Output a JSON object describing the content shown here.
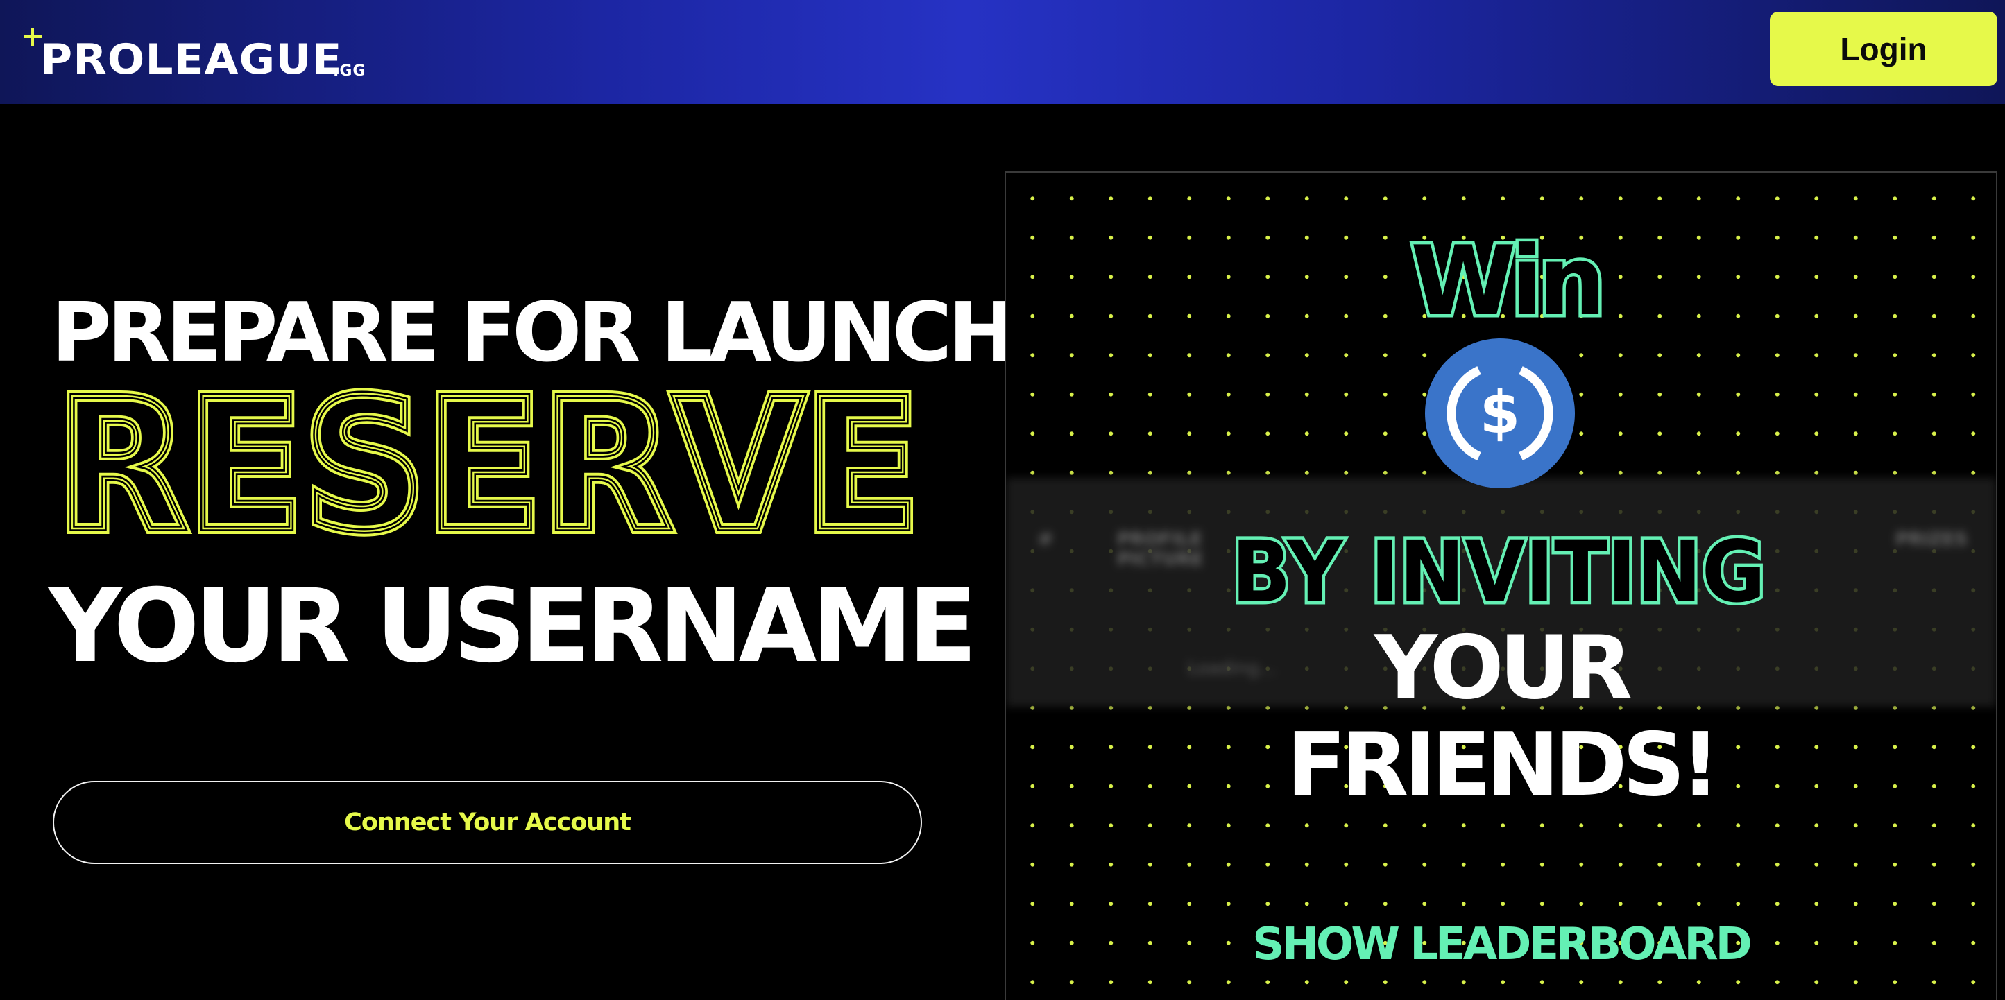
{
  "header": {
    "brand": "PROLEAGUE",
    "brand_suffix": ".GG",
    "login_label": "Login"
  },
  "hero": {
    "line1": "PREPARE FOR LAUNCH",
    "line2": "RESERVE",
    "line3": "YOUR USERNAME",
    "cta_label": "Connect Your Account"
  },
  "promo": {
    "win": "Win",
    "coin_icon": "usdc-coin-icon",
    "line_invite": "BY INVITING",
    "line_your": "YOUR",
    "line_friends": "FRIENDS!",
    "leaderboard_label": "SHOW LEADERBOARD",
    "table_headers": [
      "#",
      "PROFILE PICTURE",
      "PRIZES"
    ],
    "table_loading": "Loading..."
  },
  "colors": {
    "accent_yellow": "#e6f94a",
    "accent_green": "#64f0b4",
    "coin_blue": "#3a74c9",
    "header_blue": "#2632c4"
  }
}
